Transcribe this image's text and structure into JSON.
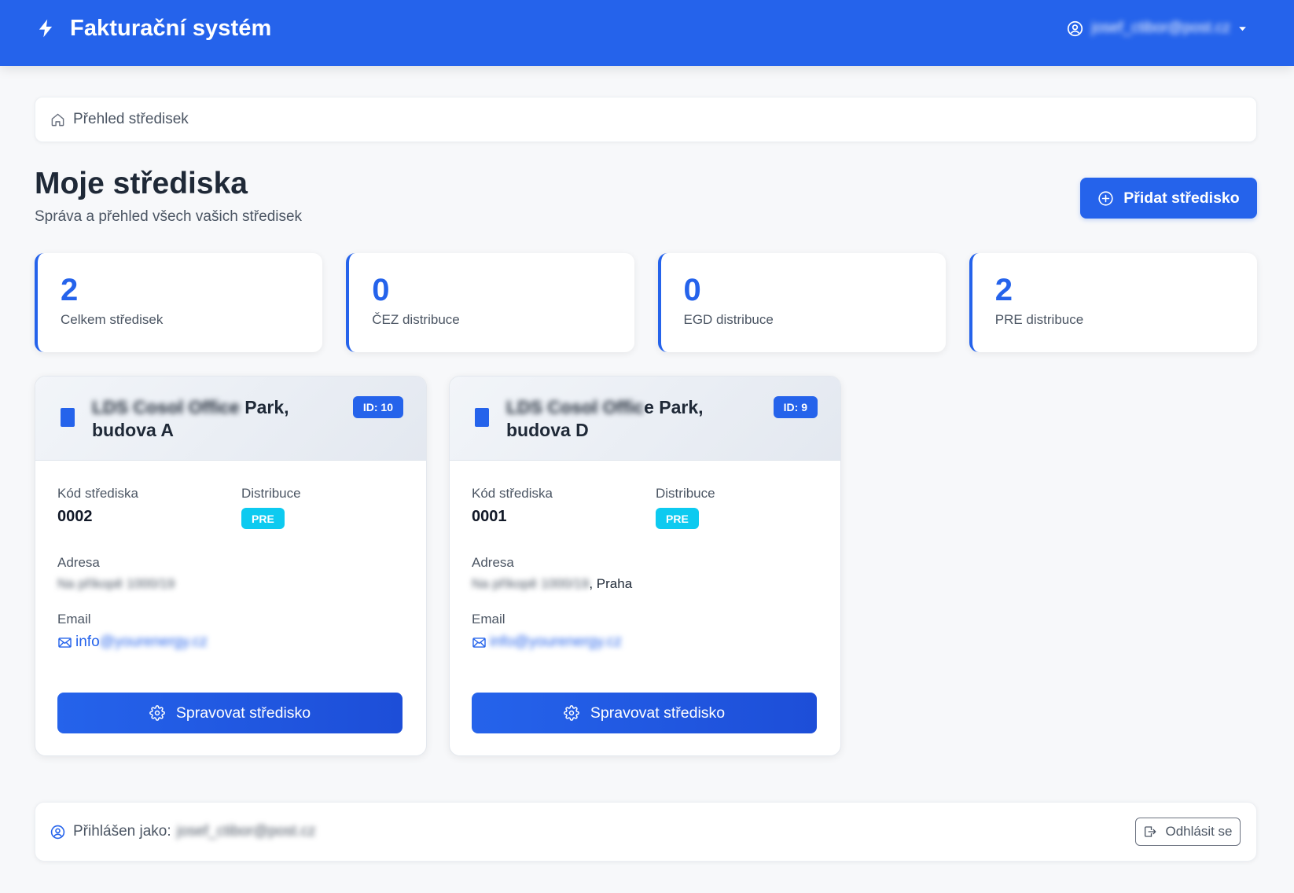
{
  "app": {
    "title": "Fakturační systém",
    "user_email": "josef_ctibor@post.cz"
  },
  "breadcrumb": {
    "label": "Přehled středisek"
  },
  "header": {
    "title": "Moje střediska",
    "subtitle": "Správa a přehled všech vašich středisek",
    "add_button": "Přidat středisko"
  },
  "stats": [
    {
      "value": "2",
      "label": "Celkem středisek"
    },
    {
      "value": "0",
      "label": "ČEZ distribuce"
    },
    {
      "value": "0",
      "label": "EGD distribuce"
    },
    {
      "value": "2",
      "label": "PRE distribuce"
    }
  ],
  "centers": [
    {
      "name_blurred": "LDS Cosol Office",
      "name_clear": " Park,",
      "name_line2": "budova A",
      "id_badge": "ID: 10",
      "code_label": "Kód střediska",
      "code": "0002",
      "distribution_label": "Distribuce",
      "distribution": "PRE",
      "address_label": "Adresa",
      "address_blurred": "Na příkopě 1000/19",
      "email_label": "Email",
      "email_clear": "info",
      "email_blurred": "@yourenergy.cz",
      "manage_button": "Spravovat středisko"
    },
    {
      "name_blurred": "LDS Cosol Offic",
      "name_clear": "e Park,",
      "name_line2": "budova D",
      "id_badge": "ID: 9",
      "code_label": "Kód střediska",
      "code": "0001",
      "distribution_label": "Distribuce",
      "distribution": "PRE",
      "address_label": "Adresa",
      "address_blurred": "Na příkopě 1000/19",
      "address_clear": ", Praha",
      "email_label": "Email",
      "email_blurred": "info@yourenergy.cz",
      "manage_button": "Spravovat středisko"
    }
  ],
  "footer": {
    "logged_in_label": "Přihlášen jako:",
    "user_email": "josef_ctibor@post.cz",
    "logout_button": "Odhlásit se"
  },
  "icons": {
    "brand": "lightning-icon",
    "user": "user-circle-icon",
    "dropdown": "caret-down-icon",
    "breadcrumb": "house-icon",
    "add": "plus-circle-icon",
    "center": "building-icon",
    "email": "envelope-icon",
    "manage": "gear-icon",
    "logout": "logout-icon"
  },
  "colors": {
    "primary": "#2563eb",
    "primary_dark": "#1d4ed8",
    "distribution_badge": "#0dcaf0",
    "background": "#f7f8fa"
  }
}
